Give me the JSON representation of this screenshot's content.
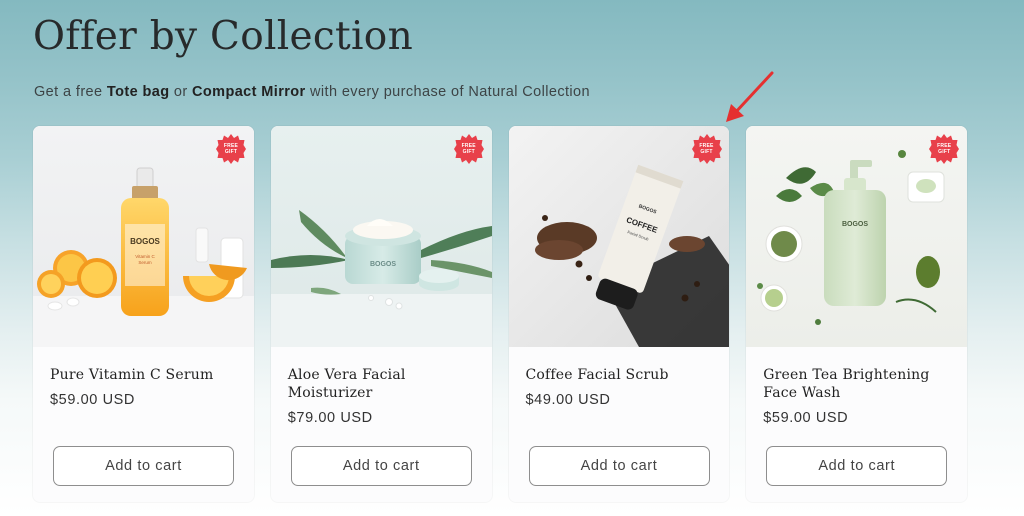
{
  "section": {
    "title": "Offer by Collection",
    "subtitle_prefix": "Get a free ",
    "subtitle_item1": "Tote bag",
    "subtitle_mid": " or ",
    "subtitle_item2": "Compact Mirror",
    "subtitle_suffix": " with every purchase of Natural Collection"
  },
  "badge": {
    "line1": "FREE",
    "line2": "GIFT",
    "color": "#e8404a"
  },
  "products": [
    {
      "title": "Pure Vitamin C Serum",
      "price": "$59.00 USD",
      "button": "Add to cart",
      "image_brand": "BOGOS",
      "image_label": "Vitamin C Serum"
    },
    {
      "title": "Aloe Vera Facial Moisturizer",
      "price": "$79.00 USD",
      "button": "Add to cart",
      "image_brand": "BOGOS"
    },
    {
      "title": "Coffee Facial Scrub",
      "price": "$49.00 USD",
      "button": "Add to cart",
      "image_brand": "BOGOS",
      "image_label": "COFFEE"
    },
    {
      "title": "Green Tea Brightening Face Wash",
      "price": "$59.00 USD",
      "button": "Add to cart",
      "image_brand": "BOGOS"
    }
  ],
  "annotation": {
    "arrow_color": "#e53030",
    "icon": "red-arrow-icon"
  }
}
